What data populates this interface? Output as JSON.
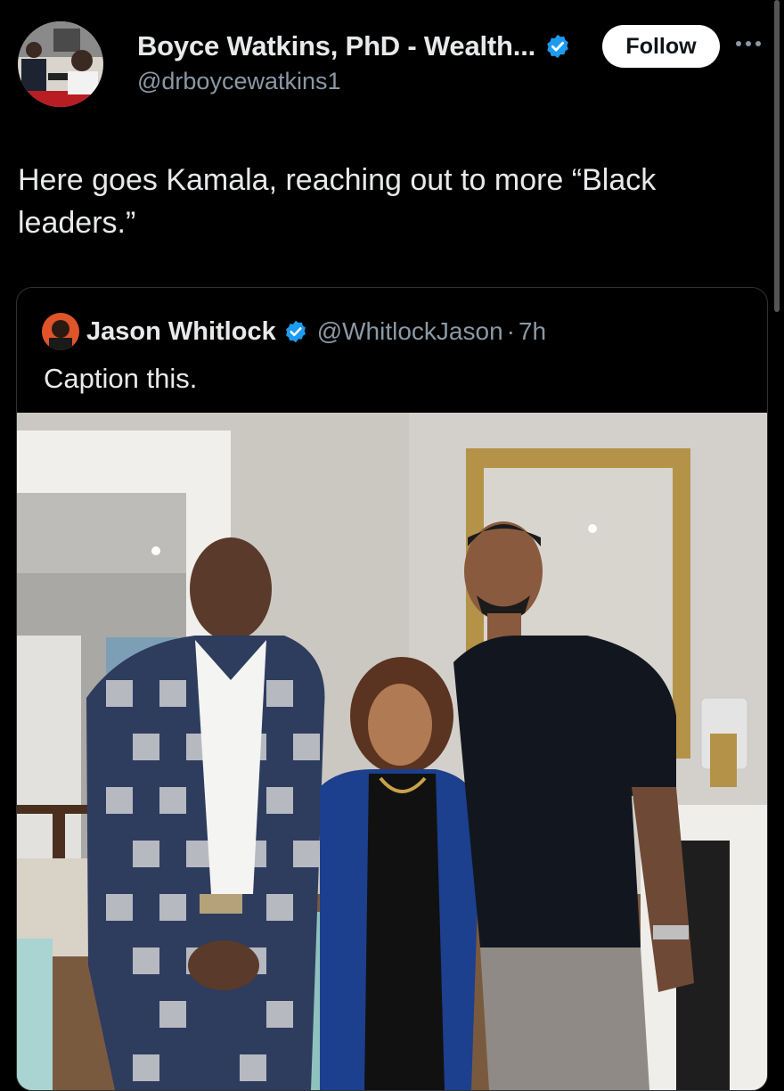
{
  "post": {
    "author_name": "Boyce Watkins, PhD - Wealth...",
    "author_handle": "@drboycewatkins1",
    "follow_label": "Follow",
    "text": "Here goes Kamala, reaching out to more “Black leaders.”"
  },
  "quoted_post": {
    "author_name": "Jason Whitlock",
    "author_handle": "@WhitlockJason",
    "separator": "·",
    "time": "7h",
    "text": "Caption this."
  },
  "icons": {
    "verified": "verified-badge-icon",
    "more": "more-options-icon"
  },
  "colors": {
    "background": "#000000",
    "verified_blue": "#1d9bf0",
    "secondary_text": "#8b98a5",
    "border": "#2f3336"
  }
}
